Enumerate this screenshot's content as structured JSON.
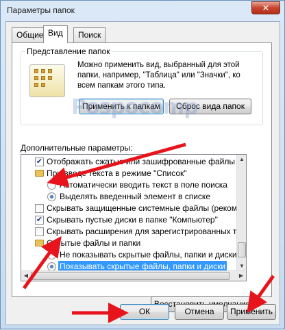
{
  "window": {
    "title": "Параметры папок",
    "close_glyph": "✕"
  },
  "tabs": [
    {
      "label": "Общие"
    },
    {
      "label": "Вид"
    },
    {
      "label": "Поиск"
    }
  ],
  "folder_view": {
    "legend": "Представление папок",
    "description": "Можно применить вид, выбранный для этой папки, например, \"Таблица\" или \"Значки\", ко всем папкам этого типа.",
    "apply_button": "Применить к папкам",
    "reset_button": "Сброс вида папок"
  },
  "watermark": "Pospocomp",
  "advanced": {
    "label": "Дополнительные параметры:",
    "items": [
      {
        "type": "checkbox",
        "checked": true,
        "level": 1,
        "label": "Отображать сжатые или зашифрованные файлы NTFS"
      },
      {
        "type": "folder",
        "level": 1,
        "label": "При вводе текста в режиме \"Список\""
      },
      {
        "type": "radio",
        "checked": false,
        "level": 2,
        "label": "Автоматически вводить текст в поле поиска"
      },
      {
        "type": "radio",
        "checked": true,
        "level": 2,
        "label": "Выделять введенный элемент в списке"
      },
      {
        "type": "checkbox",
        "checked": false,
        "level": 1,
        "label": "Скрывать защищенные системные файлы (рекомендуется)"
      },
      {
        "type": "checkbox",
        "checked": true,
        "level": 1,
        "label": "Скрывать пустые диски в папке \"Компьютер\""
      },
      {
        "type": "checkbox",
        "checked": false,
        "level": 1,
        "label": "Скрывать расширения для зарегистрированных типов"
      },
      {
        "type": "folder",
        "level": 1,
        "label": "Скрытые файлы и папки"
      },
      {
        "type": "radio",
        "checked": false,
        "level": 2,
        "label": "Не показывать скрытые файлы, папки и диски"
      },
      {
        "type": "radio",
        "checked": true,
        "level": 2,
        "selected": true,
        "label": "Показывать скрытые файлы, папки и диски"
      }
    ]
  },
  "restore_button": "Восстановить умолчания",
  "footer": {
    "ok": "ОК",
    "cancel": "Отмена",
    "apply": "Применить"
  },
  "colors": {
    "selection": "#3399ff",
    "arrow": "#e8141b"
  },
  "icons": {
    "close": "close-icon",
    "folder_view": "folder-view-icon",
    "tree_folder": "folder-icon",
    "scroll_up": "chevron-up-icon",
    "scroll_down": "chevron-down-icon",
    "scroll_left": "chevron-left-icon",
    "scroll_right": "chevron-right-icon"
  }
}
